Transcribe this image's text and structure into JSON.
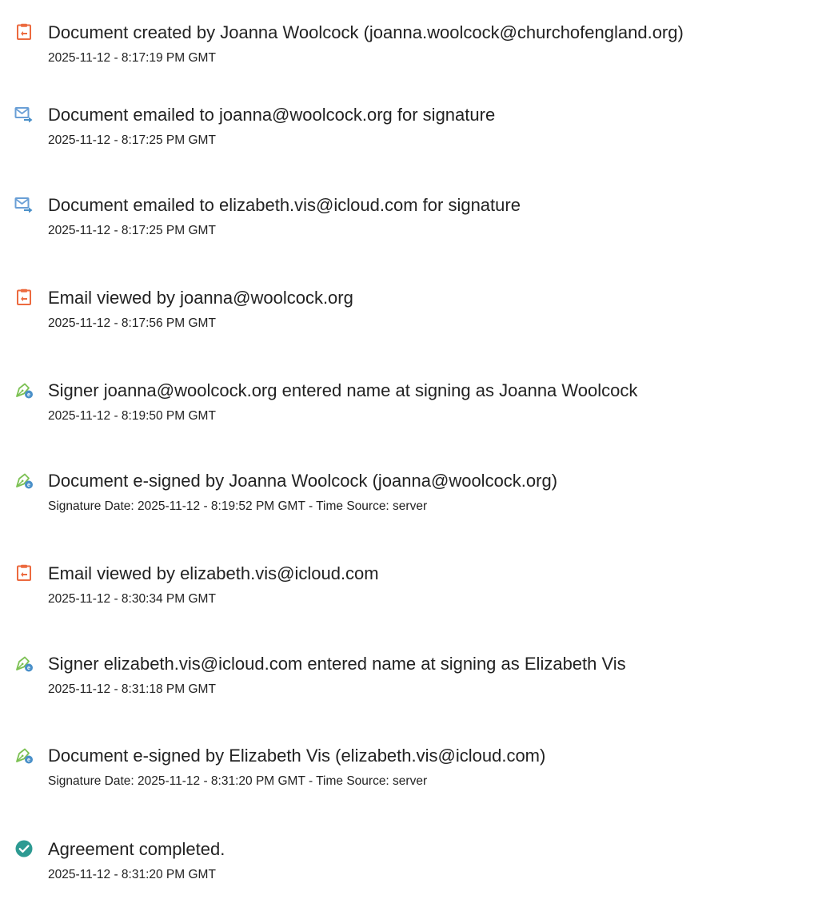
{
  "colors": {
    "document": "#ec6a3f",
    "email": "#6a9fd6",
    "sign_pen": "#7cc153",
    "sign_badge": "#4a90c9",
    "complete": "#2d9a92",
    "text": "#222222"
  },
  "events": [
    {
      "icon": "document-icon",
      "title": "Document created by Joanna Woolcock (joanna.woolcock@churchofengland.org)",
      "time": "2025-11-12 - 8:17:19 PM GMT"
    },
    {
      "icon": "email-sent-icon",
      "title": "Document emailed to joanna@woolcock.org for signature",
      "time": "2025-11-12 - 8:17:25 PM GMT"
    },
    {
      "icon": "email-sent-icon",
      "title": "Document emailed to elizabeth.vis@icloud.com for signature",
      "time": "2025-11-12 - 8:17:25 PM GMT"
    },
    {
      "icon": "document-icon",
      "title": "Email viewed by joanna@woolcock.org",
      "time": "2025-11-12 - 8:17:56 PM GMT"
    },
    {
      "icon": "e-sign-icon",
      "title": "Signer joanna@woolcock.org entered name at signing as Joanna Woolcock",
      "time": "2025-11-12 - 8:19:50 PM GMT"
    },
    {
      "icon": "e-sign-icon",
      "title": "Document e-signed by Joanna Woolcock (joanna@woolcock.org)",
      "time": "Signature Date: 2025-11-12 - 8:19:52 PM GMT - Time Source: server"
    },
    {
      "icon": "document-icon",
      "title": "Email viewed by elizabeth.vis@icloud.com",
      "time": "2025-11-12 - 8:30:34 PM GMT"
    },
    {
      "icon": "e-sign-icon",
      "title": "Signer elizabeth.vis@icloud.com entered name at signing as Elizabeth Vis",
      "time": "2025-11-12 - 8:31:18 PM GMT"
    },
    {
      "icon": "e-sign-icon",
      "title": "Document e-signed by Elizabeth Vis (elizabeth.vis@icloud.com)",
      "time": "Signature Date: 2025-11-12 - 8:31:20 PM GMT - Time Source: server"
    },
    {
      "icon": "check-circle-icon",
      "title": "Agreement completed.",
      "time": "2025-11-12 - 8:31:20 PM GMT"
    }
  ]
}
